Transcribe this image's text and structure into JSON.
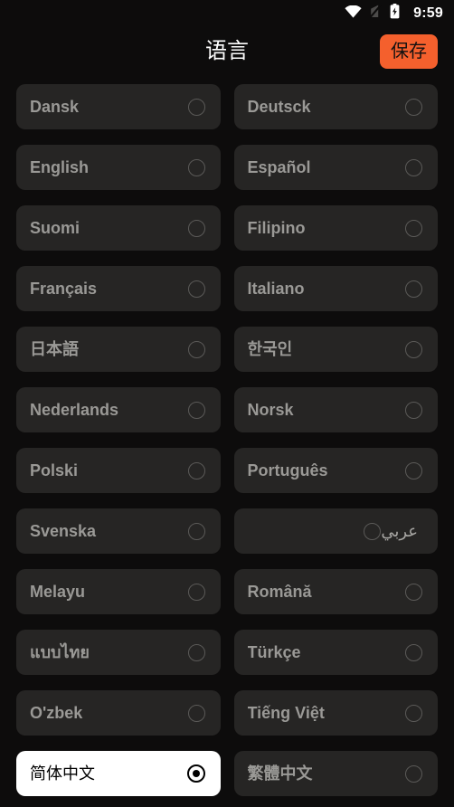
{
  "status_bar": {
    "wifi_icon": "wifi-icon",
    "signal_off_icon": "signal-off-icon",
    "battery_charging_icon": "battery-charging-icon",
    "time": "9:59"
  },
  "header": {
    "title": "语言",
    "save_label": "保存",
    "save_color": "#f4602d"
  },
  "languages": [
    {
      "label": "Dansk",
      "selected": false,
      "rtl": false
    },
    {
      "label": "Deutsck",
      "selected": false,
      "rtl": false
    },
    {
      "label": "English",
      "selected": false,
      "rtl": false
    },
    {
      "label": "Español",
      "selected": false,
      "rtl": false
    },
    {
      "label": "Suomi",
      "selected": false,
      "rtl": false
    },
    {
      "label": "Filipino",
      "selected": false,
      "rtl": false
    },
    {
      "label": "Français",
      "selected": false,
      "rtl": false
    },
    {
      "label": "Italiano",
      "selected": false,
      "rtl": false
    },
    {
      "label": "日本語",
      "selected": false,
      "rtl": false
    },
    {
      "label": "한국인",
      "selected": false,
      "rtl": false
    },
    {
      "label": "Nederlands",
      "selected": false,
      "rtl": false
    },
    {
      "label": "Norsk",
      "selected": false,
      "rtl": false
    },
    {
      "label": "Polski",
      "selected": false,
      "rtl": false
    },
    {
      "label": "Português",
      "selected": false,
      "rtl": false
    },
    {
      "label": "Svenska",
      "selected": false,
      "rtl": false
    },
    {
      "label": "عربي",
      "selected": false,
      "rtl": true
    },
    {
      "label": "Melayu",
      "selected": false,
      "rtl": false
    },
    {
      "label": "Română",
      "selected": false,
      "rtl": false
    },
    {
      "label": "แบบไทย",
      "selected": false,
      "rtl": false
    },
    {
      "label": "Türkçe",
      "selected": false,
      "rtl": false
    },
    {
      "label": "O'zbek",
      "selected": false,
      "rtl": false
    },
    {
      "label": "Tiếng Việt",
      "selected": false,
      "rtl": false
    },
    {
      "label": "简体中文",
      "selected": true,
      "rtl": false
    },
    {
      "label": "繁體中文",
      "selected": false,
      "rtl": false
    }
  ]
}
